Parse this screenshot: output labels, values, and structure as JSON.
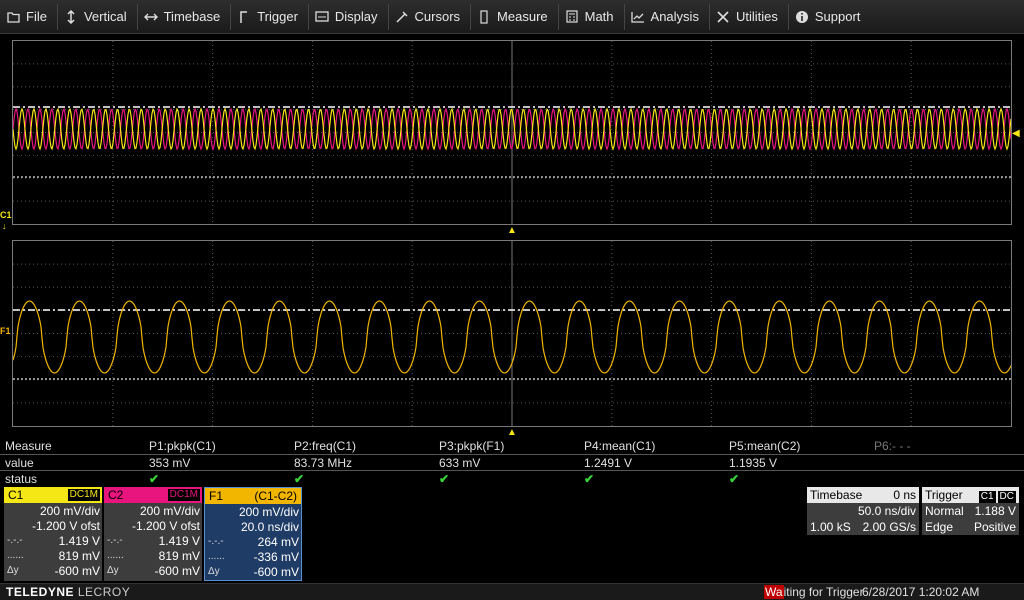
{
  "menu": [
    {
      "label": "File",
      "icon": "folder-icon"
    },
    {
      "label": "Vertical",
      "icon": "vertical-arrows-icon"
    },
    {
      "label": "Timebase",
      "icon": "horizontal-arrows-icon"
    },
    {
      "label": "Trigger",
      "icon": "trigger-edge-icon"
    },
    {
      "label": "Display",
      "icon": "display-icon"
    },
    {
      "label": "Cursors",
      "icon": "cursor-icon"
    },
    {
      "label": "Measure",
      "icon": "measure-icon"
    },
    {
      "label": "Math",
      "icon": "calculator-icon"
    },
    {
      "label": "Analysis",
      "icon": "analysis-chart-icon"
    },
    {
      "label": "Utilities",
      "icon": "tools-icon"
    },
    {
      "label": "Support",
      "icon": "info-icon"
    }
  ],
  "grid_labels": {
    "c1": "C1",
    "f1": "F1"
  },
  "measure": {
    "header_label": "Measure",
    "value_label": "value",
    "status_label": "status",
    "params": [
      {
        "name": "P1:pkpk(C1)",
        "value": "353 mV",
        "status": "✔"
      },
      {
        "name": "P2:freq(C1)",
        "value": "83.73 MHz",
        "status": "✔"
      },
      {
        "name": "P3:pkpk(F1)",
        "value": "633 mV",
        "status": "✔"
      },
      {
        "name": "P4:mean(C1)",
        "value": "1.2491 V",
        "status": "✔"
      },
      {
        "name": "P5:mean(C2)",
        "value": "1.1935 V",
        "status": "✔"
      },
      {
        "name": "P6:- - -",
        "value": "",
        "status": ""
      }
    ]
  },
  "descriptors": [
    {
      "name": "C1",
      "tag": "DC1M",
      "color": "#f5e616",
      "rows": [
        [
          "",
          "200 mV/div"
        ],
        [
          "",
          "-1.200 V ofst"
        ],
        [
          "-.-.-",
          "1.419 V"
        ],
        [
          "......",
          "819 mV"
        ],
        [
          "Δy",
          "-600 mV"
        ]
      ]
    },
    {
      "name": "C2",
      "tag": "DC1M",
      "color": "#e8157f",
      "rows": [
        [
          "",
          "200 mV/div"
        ],
        [
          "",
          "-1.200 V ofst"
        ],
        [
          "-.-.-",
          "1.419 V"
        ],
        [
          "......",
          "819 mV"
        ],
        [
          "Δy",
          "-600 mV"
        ]
      ]
    },
    {
      "name": "F1",
      "tag": "(C1-C2)",
      "color": "#f2b500",
      "rows": [
        [
          "",
          "200 mV/div"
        ],
        [
          "",
          "20.0 ns/div"
        ],
        [
          "-.-.-",
          "264 mV"
        ],
        [
          "......",
          "-336 mV"
        ],
        [
          "Δy",
          "-600 mV"
        ]
      ]
    }
  ],
  "timebase": {
    "title": "Timebase",
    "delay": "0 ns",
    "per_div": "50.0 ns/div",
    "samples": "1.00 kS",
    "rate": "2.00 GS/s"
  },
  "trigger": {
    "title": "Trigger",
    "src": "C1",
    "coupling": "DC",
    "mode": "Normal",
    "level": "1.188 V",
    "type": "Edge",
    "slope": "Positive"
  },
  "status": {
    "brand1": "TELEDYNE",
    "brand2": " LECROY",
    "trigger_wa": "Wa",
    "trigger_rest": "iting for Trigger",
    "datetime": "6/28/2017 1:20:02 AM"
  },
  "colors": {
    "c1": "#f5e616",
    "c2": "#e8157f",
    "f1": "#f2b500"
  }
}
